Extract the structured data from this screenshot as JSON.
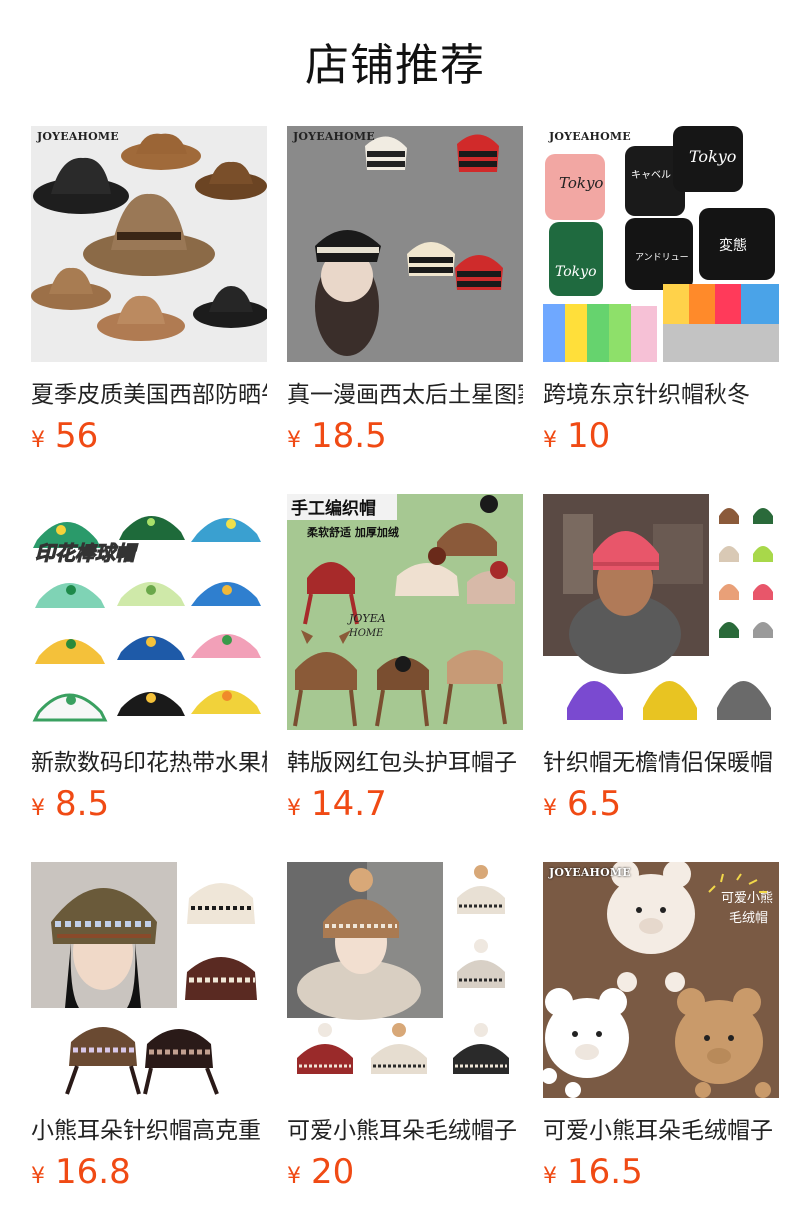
{
  "header": {
    "title": "店铺推荐"
  },
  "currency_symbol": "¥",
  "colors": {
    "price": "#f04a14",
    "title_text": "#222222"
  },
  "products": [
    {
      "title": "夏季皮质美国西部防晒牛仔帽",
      "price": "56",
      "brand": "JOYEAHOME",
      "image": "cowboy-hats-image"
    },
    {
      "title": "真一漫画西太后土星图案条纹护耳针织帽",
      "price": "18.5",
      "brand": "JOYEAHOME",
      "image": "striped-earflap-beanies-image"
    },
    {
      "title": "跨境东京针织帽秋冬",
      "price": "10",
      "brand": "JOYEAHOME",
      "image": "tokyo-beanies-image",
      "overlay_text": [
        "Tokyo",
        "キャベル",
        "アンドリュー",
        "変態"
      ]
    },
    {
      "title": "新款数码印花热带水果棒球帽",
      "price": "8.5",
      "image": "printed-baseball-caps-image",
      "overlay_text": [
        "印花棒球帽"
      ]
    },
    {
      "title": "韩版网红包头护耳帽子",
      "price": "14.7",
      "image": "handmade-knit-hats-image",
      "overlay_text": [
        "手工编织帽",
        "柔软舒适 加厚加绒",
        "JOYEA HOME"
      ]
    },
    {
      "title": "针织帽无檐情侣保暖帽",
      "price": "6.5",
      "image": "plain-knit-beanies-image"
    },
    {
      "title": "小熊耳朵针织帽高克重",
      "price": "16.8",
      "image": "fair-isle-knit-hat-image"
    },
    {
      "title": "可爱小熊耳朵毛绒帽子",
      "price": "20",
      "image": "pompom-earflap-hats-image"
    },
    {
      "title": "可爱小熊耳朵毛绒帽子",
      "price": "16.5",
      "brand": "JOYEAHOME",
      "image": "bear-ear-plush-hats-image",
      "overlay_text": [
        "可爱小熊",
        "毛绒帽"
      ]
    }
  ]
}
